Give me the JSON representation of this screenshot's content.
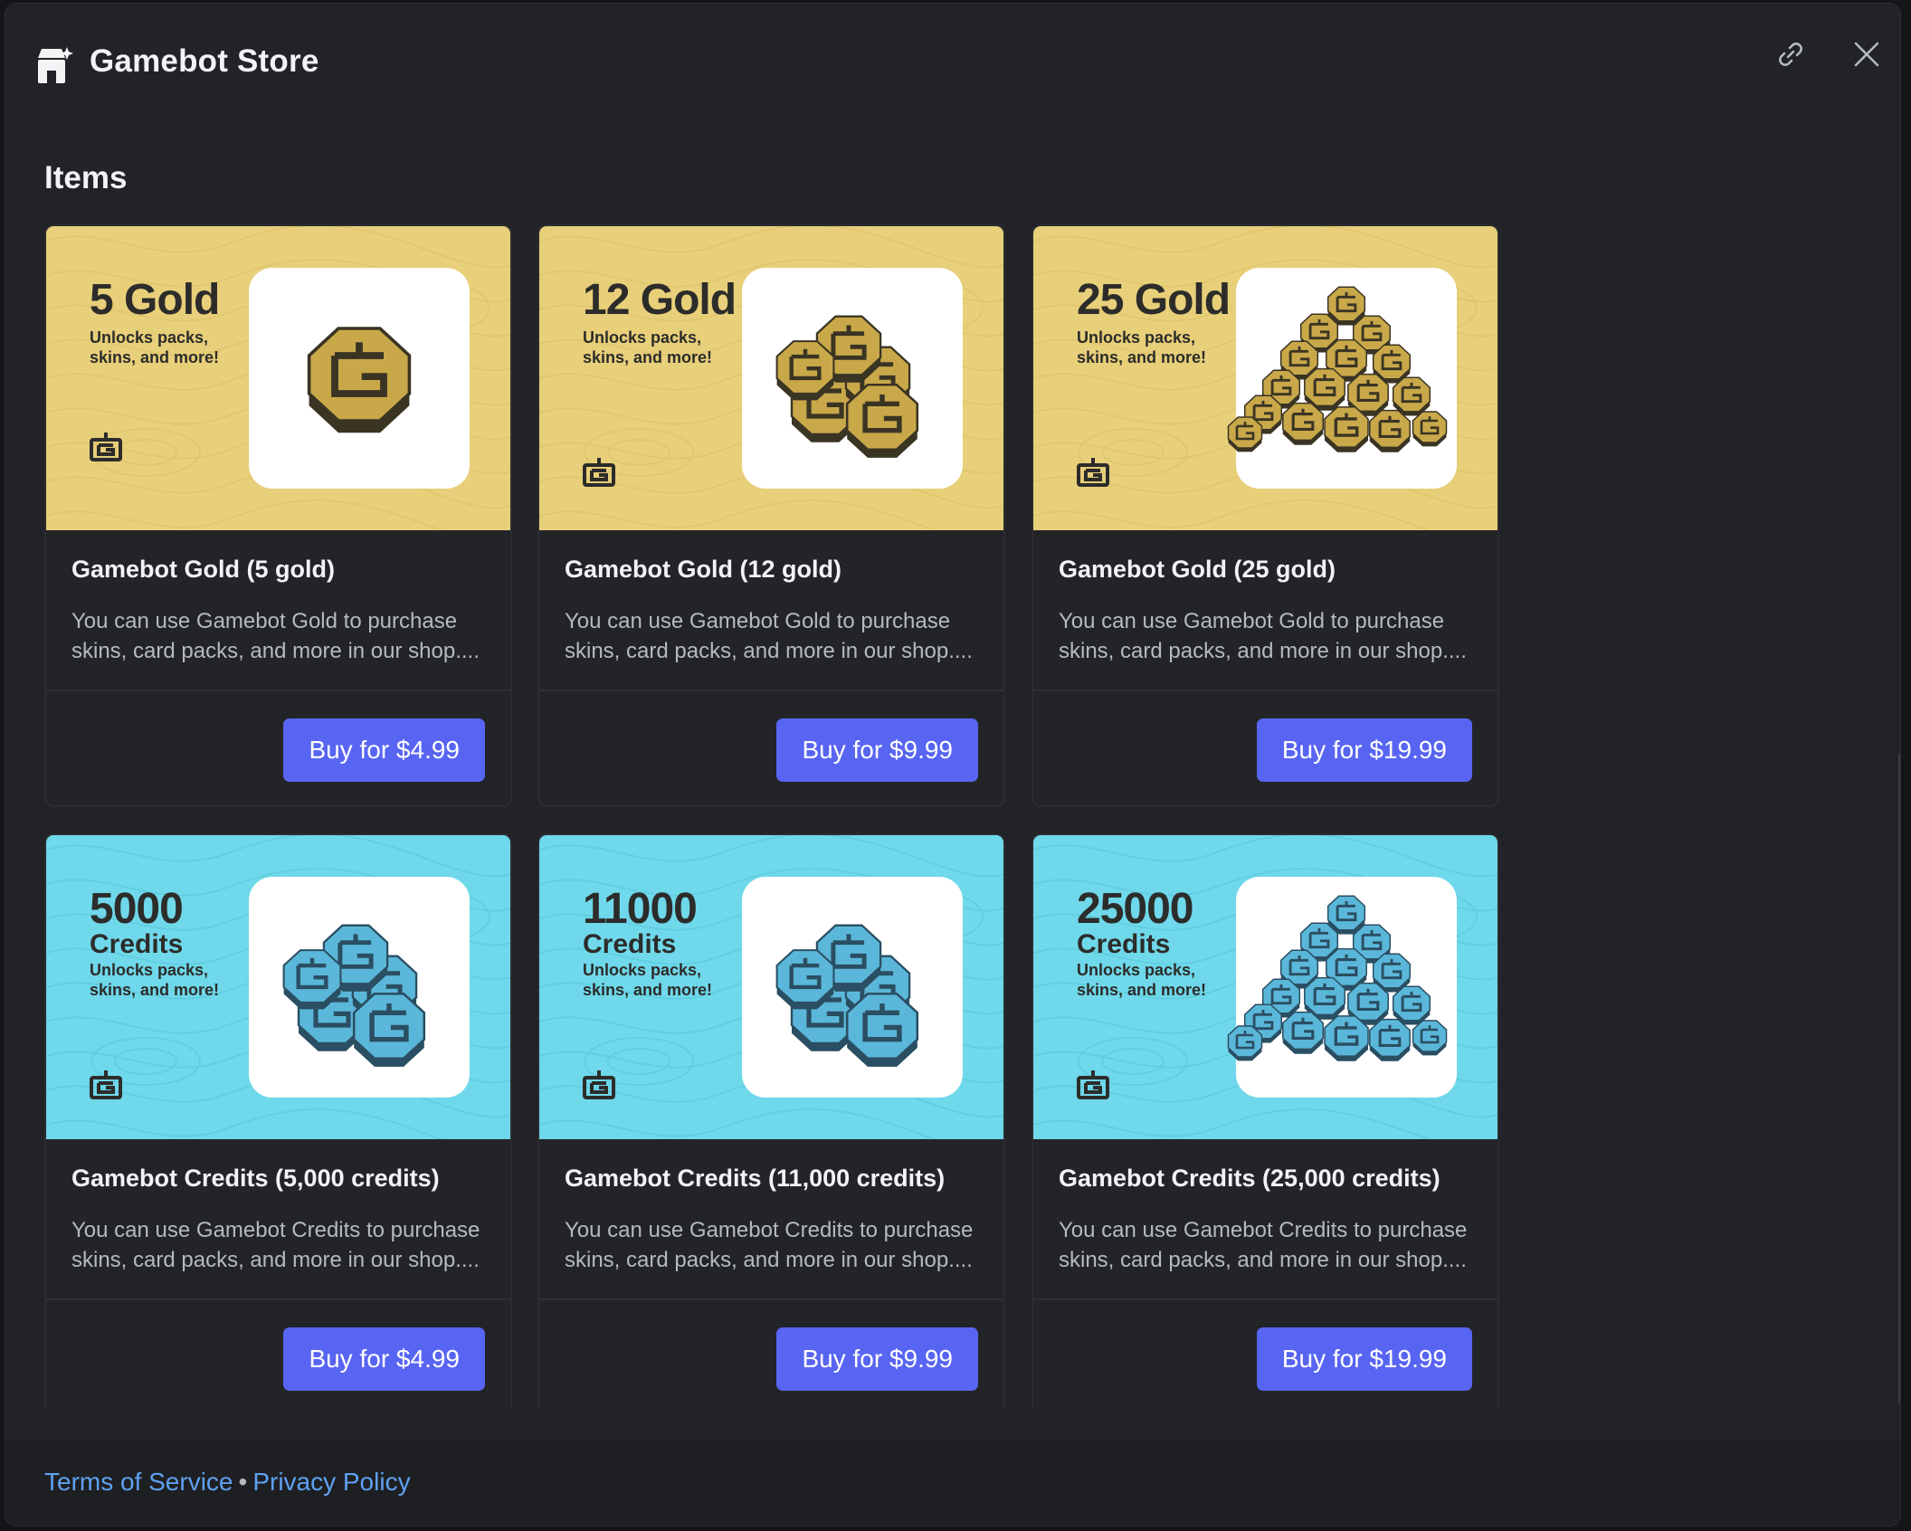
{
  "header": {
    "title": "Gamebot Store",
    "icons": {
      "store": "store-icon",
      "link": "link-icon",
      "close": "close-icon"
    }
  },
  "section_title": "Items",
  "items": [
    {
      "kind": "gold",
      "banner_amount": "5 Gold",
      "banner_unit": "",
      "banner_tagline": "Unlocks packs, skins, and more!",
      "title": "Gamebot Gold (5 gold)",
      "description": "You can use Gamebot Gold to purchase skins, card packs, and more in our shop....",
      "button": "Buy for $4.99",
      "coins": 1
    },
    {
      "kind": "gold",
      "banner_amount": "12 Gold",
      "banner_unit": "",
      "banner_tagline": "Unlocks packs, skins, and more!",
      "title": "Gamebot Gold (12 gold)",
      "description": "You can use Gamebot Gold to purchase skins, card packs, and more in our shop....",
      "button": "Buy for $9.99",
      "coins": 5
    },
    {
      "kind": "gold",
      "banner_amount": "25 Gold",
      "banner_unit": "",
      "banner_tagline": "Unlocks packs, skins, and more!",
      "title": "Gamebot Gold (25 gold)",
      "description": "You can use Gamebot Gold to purchase skins, card packs, and more in our shop....",
      "button": "Buy for $19.99",
      "coins": 14
    },
    {
      "kind": "credits",
      "banner_amount": "5000",
      "banner_unit": "Credits",
      "banner_tagline": "Unlocks packs, skins, and more!",
      "title": "Gamebot Credits (5,000 credits)",
      "description": "You can use Gamebot Credits to purchase skins, card packs, and more in our shop....",
      "button": "Buy for $4.99",
      "coins": 5
    },
    {
      "kind": "credits",
      "banner_amount": "11000",
      "banner_unit": "Credits",
      "banner_tagline": "Unlocks packs, skins, and more!",
      "title": "Gamebot Credits (11,000 credits)",
      "description": "You can use Gamebot Credits to purchase skins, card packs, and more in our shop....",
      "button": "Buy for $9.99",
      "coins": 5
    },
    {
      "kind": "credits",
      "banner_amount": "25000",
      "banner_unit": "Credits",
      "banner_tagline": "Unlocks packs, skins, and more!",
      "title": "Gamebot Credits (25,000 credits)",
      "description": "You can use Gamebot Credits to purchase skins, card packs, and more in our shop....",
      "button": "Buy for $19.99",
      "coins": 14
    }
  ],
  "footer": {
    "terms": "Terms of Service",
    "separator": "•",
    "privacy": "Privacy Policy"
  },
  "colors": {
    "accent": "#5865f2",
    "link": "#5ea1f2",
    "gold_banner": "#e8cf7a",
    "credits_banner": "#6fd8ea",
    "gold_coin": "#c9a84a",
    "credits_coin": "#5bb7d9"
  }
}
